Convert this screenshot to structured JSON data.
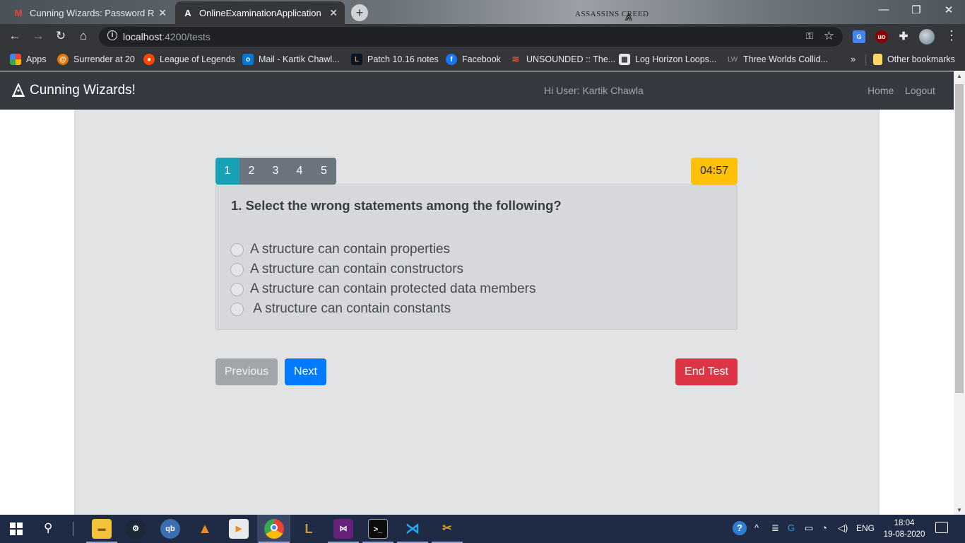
{
  "browser": {
    "tabs": [
      {
        "title": "Cunning Wizards: Password Rese",
        "icon": "gmail-icon",
        "active": false
      },
      {
        "title": "OnlineExaminationApplication",
        "icon": "angular-icon",
        "active": true
      }
    ],
    "theme_logo": "ASSASSINS CREED",
    "url_host": "localhost",
    "url_path": ":4200/tests",
    "bookmarks": [
      {
        "label": "Apps",
        "icon": "apps-grid-icon",
        "color": "#f4b400"
      },
      {
        "label": "Surrender at 20",
        "icon": "surrender-icon",
        "color": "#e37400"
      },
      {
        "label": "League of Legends",
        "icon": "reddit-icon",
        "color": "#ff4500"
      },
      {
        "label": "Mail - Kartik Chawl...",
        "icon": "outlook-icon",
        "color": "#0078d4"
      },
      {
        "label": "Patch 10.16 notes",
        "icon": "lol-icon",
        "color": "#c89b3c"
      },
      {
        "label": "Facebook",
        "icon": "facebook-icon",
        "color": "#1877f2"
      },
      {
        "label": "UNSOUNDED :: The...",
        "icon": "unsounded-icon",
        "color": "#c0392b"
      },
      {
        "label": "Log Horizon Loops...",
        "icon": "page-icon",
        "color": "#5f6368"
      },
      {
        "label": "Three Worlds Collid...",
        "icon": "lw-icon",
        "color": "#5f6368"
      }
    ],
    "bookmarks_more": "»",
    "other_bookmarks": "Other bookmarks"
  },
  "navbar": {
    "brand": "Cunning Wizards!",
    "greeting": "Hi User: Kartik Chawla",
    "links": [
      "Home",
      "Logout"
    ]
  },
  "exam": {
    "question_numbers": [
      "1",
      "2",
      "3",
      "4",
      "5"
    ],
    "active_question": "1",
    "timer": "04:57",
    "question": "1. Select the wrong statements among the following?",
    "options": [
      "A structure can contain properties",
      "A structure can contain constructors",
      "A structure can contain protected data members",
      " A structure can contain constants"
    ],
    "buttons": {
      "previous": "Previous",
      "next": "Next",
      "end": "End Test"
    },
    "colors": {
      "active_q": "#17a2b8",
      "timer": "#ffc107",
      "next": "#007bff",
      "end": "#dc3545"
    }
  },
  "taskbar": {
    "apps": [
      "file-explorer-icon",
      "steam-icon",
      "qbittorrent-icon",
      "vlc-icon",
      "media-player-icon",
      "chrome-icon",
      "league-client-icon",
      "visual-studio-icon",
      "terminal-icon",
      "vscode-icon",
      "tools-icon"
    ],
    "language": "ENG",
    "time": "18:04",
    "date": "19-08-2020"
  }
}
